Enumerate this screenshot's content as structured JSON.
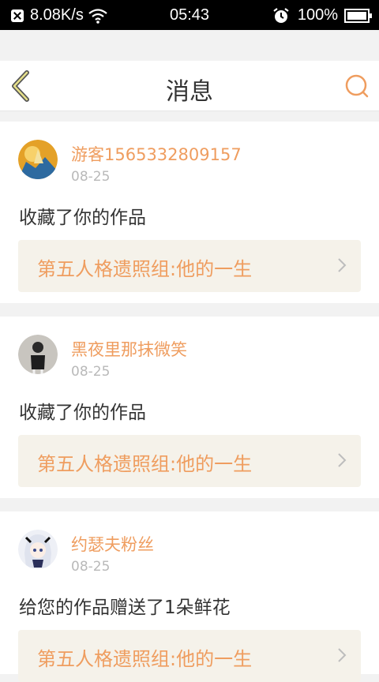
{
  "status_bar": {
    "network_speed": "8.08K/s",
    "time": "05:43",
    "battery": "100%"
  },
  "header": {
    "title": "消息"
  },
  "messages": [
    {
      "username": "游客1565332809157",
      "date": "08-25",
      "action": "收藏了你的作品",
      "work_title": "第五人格遗照组:他的一生"
    },
    {
      "username": "黑夜里那抹微笑",
      "date": "08-25",
      "action": "收藏了你的作品",
      "work_title": "第五人格遗照组:他的一生"
    },
    {
      "username": "约瑟夫粉丝",
      "date": "08-25",
      "action": "给您的作品赠送了1朵鲜花",
      "work_title": "第五人格遗照组:他的一生"
    }
  ],
  "colors": {
    "accent": "#ef9d5f",
    "work_box_bg": "#f5f2ea",
    "page_bg": "#f2f2f2"
  },
  "icons": [
    "close-notification-icon",
    "wifi-icon",
    "alarm-icon",
    "battery-icon",
    "back-arrow-icon",
    "search-icon",
    "chevron-right-icon"
  ]
}
